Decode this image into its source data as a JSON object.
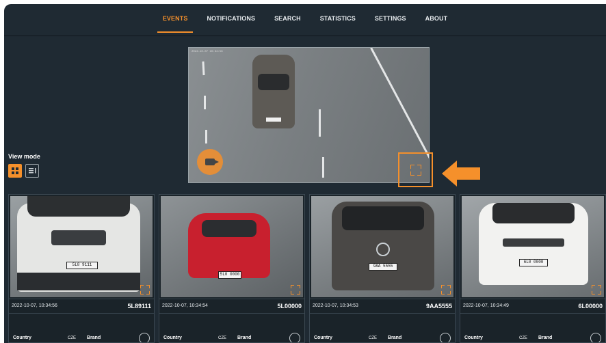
{
  "nav": {
    "items": [
      {
        "label": "EVENTS",
        "active": true
      },
      {
        "label": "NOTIFICATIONS",
        "active": false
      },
      {
        "label": "SEARCH",
        "active": false
      },
      {
        "label": "STATISTICS",
        "active": false
      },
      {
        "label": "SETTINGS",
        "active": false
      },
      {
        "label": "ABOUT",
        "active": false
      }
    ]
  },
  "preview": {
    "caption": "2022-10-07 10:34:56",
    "plate": "5L8 9111",
    "camera_icon": "video-camera-icon",
    "fullscreen_icon": "fullscreen-icon"
  },
  "view_mode": {
    "label": "View mode",
    "options": [
      "grid-view-icon",
      "list-view-icon"
    ],
    "selected": "grid"
  },
  "cards": [
    {
      "time": "2022-10-07, 10:34:56",
      "plate": "5L89111",
      "image_plate": "5L8 9111",
      "country_label": "Country",
      "country": "CZE",
      "brand_label": "Brand",
      "brand_icon": "peugeot-logo-icon",
      "car_color": "#e8e8e6"
    },
    {
      "time": "2022-10-07, 10:34:54",
      "plate": "5L00000",
      "image_plate": "5L0 0000",
      "country_label": "Country",
      "country": "CZE",
      "brand_label": "Brand",
      "brand_icon": "mazda-logo-icon",
      "car_color": "#c8202e"
    },
    {
      "time": "2022-10-07, 10:34:53",
      "plate": "9AA5555",
      "image_plate": "9AA 5555",
      "country_label": "Country",
      "country": "CZE",
      "brand_label": "Brand",
      "brand_icon": "volkswagen-logo-icon",
      "car_color": "#4a4846"
    },
    {
      "time": "2022-10-07, 10:34:49",
      "plate": "6L00000",
      "image_plate": "6L0 0000",
      "country_label": "Country",
      "country": "CZE",
      "brand_label": "Brand",
      "brand_icon": "skoda-logo-icon",
      "car_color": "#f2f2f0"
    }
  ],
  "colors": {
    "accent": "#f5902b",
    "background": "#1f2a33"
  }
}
